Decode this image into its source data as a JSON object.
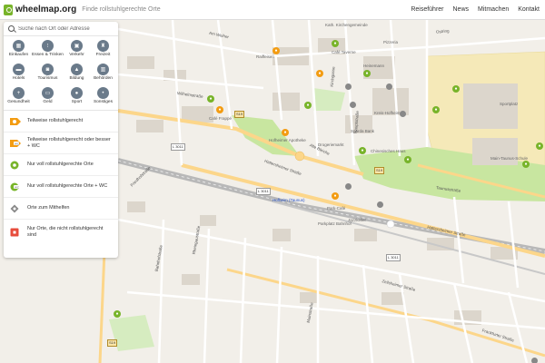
{
  "header": {
    "logo": "wheelmap.org",
    "tagline": "Finde rollstuhlgerechte Orte",
    "nav": [
      "Reiseführer",
      "News",
      "Mitmachen",
      "Kontakt"
    ]
  },
  "search": {
    "placeholder": "Suche nach Ort oder Adresse",
    "value": ""
  },
  "categories": [
    {
      "label": "Einkaufen",
      "icon": "shopping-cart-icon"
    },
    {
      "label": "Essen & Trinken",
      "icon": "utensils-icon"
    },
    {
      "label": "Verkehr",
      "icon": "bus-icon"
    },
    {
      "label": "Freizeit",
      "icon": "leisure-icon"
    },
    {
      "label": "Hotels",
      "icon": "bed-icon"
    },
    {
      "label": "Tourismus",
      "icon": "camera-icon"
    },
    {
      "label": "Bildung",
      "icon": "school-icon"
    },
    {
      "label": "Behörden",
      "icon": "building-icon"
    },
    {
      "label": "Gesundheit",
      "icon": "health-cross-icon"
    },
    {
      "label": "Geld",
      "icon": "money-icon"
    },
    {
      "label": "Sport",
      "icon": "sport-icon"
    },
    {
      "label": "Sonstiges",
      "icon": "more-icon"
    }
  ],
  "filters": [
    {
      "label": "Teilweise rollstuhlgerecht",
      "color": "#f39c12",
      "wc": false
    },
    {
      "label": "Teilweise rollstuhlgerecht oder besser + WC",
      "color": "#f39c12",
      "wc": true
    },
    {
      "label": "Nur voll rollstuhlgerechte Orte",
      "color": "#78b42a",
      "wc": false
    },
    {
      "label": "Nur voll rollstuhlgerechte Orte + WC",
      "color": "#78b42a",
      "wc": true
    },
    {
      "label": "Orte zum Mithelfen",
      "color": "#888888",
      "wc": false
    },
    {
      "label": "Nur Orte, die nicht rollstuhlgerecht sind",
      "color": "#e74c3c",
      "wc": false
    }
  ],
  "map": {
    "street_labels": [
      "Am Weiher",
      "Wilhelmstraße",
      "Friedhofstraße",
      "Hattersheimer Straße",
      "Bahnhofstraße",
      "Hofheim (Taunus)",
      "Hattersheimer Straße",
      "Frankfurter Straße",
      "Kirchgasse",
      "Hauptstraße",
      "Alte Bleiche",
      "Taunusstraße",
      "Rheingaustraße",
      "Mainstraße",
      "Ostring",
      "Zeilsheimer Straße"
    ],
    "road_shields": [
      "S19",
      "S19",
      "L 3011",
      "L 3011",
      "L 3011",
      "S19"
    ],
    "poi_labels": [
      "Kath. Kirchengemeinde",
      "Pizzeria",
      "Café Taverne",
      "Heinemann",
      "Raiffeisen",
      "Café Frappé",
      "Sparda Bank",
      "Hofheimer Apotheke",
      "Drogeriemarkt",
      "Kreis-Hofheim",
      "Chinesisches Haus",
      "Park-Café",
      "Sportplatz",
      "Main-Taunus-Schule",
      "Jazzkeller",
      "Parkplatz Bahnhof"
    ],
    "colors": {
      "background": "#f2efe9",
      "park": "#c8e6a0",
      "school_area": "#f5e9b8",
      "rail": "#bbbbbb",
      "road": "#ffffff",
      "main_road": "#fcd68a"
    }
  }
}
